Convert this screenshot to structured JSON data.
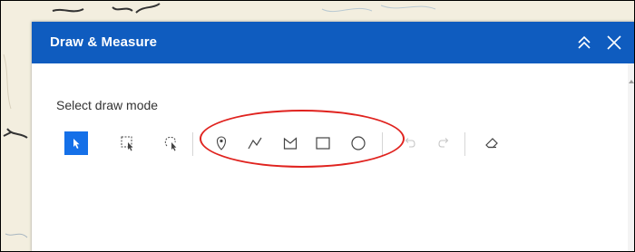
{
  "panel": {
    "title": "Draw & Measure",
    "header_color": "#0f5cbf"
  },
  "header_icons": [
    "collapse-up-icon",
    "close-icon"
  ],
  "draw": {
    "mode_label": "Select draw mode",
    "active_tool": "select-cursor-icon",
    "active_color": "#1570e8",
    "tools": [
      "select-cursor-icon",
      "rectangle-select-icon",
      "lasso-select-icon",
      "point-icon",
      "polyline-icon",
      "polygon-icon",
      "rectangle-icon",
      "circle-icon",
      "undo-icon",
      "redo-icon",
      "eraser-icon"
    ],
    "annotation_color": "#e0231f"
  }
}
